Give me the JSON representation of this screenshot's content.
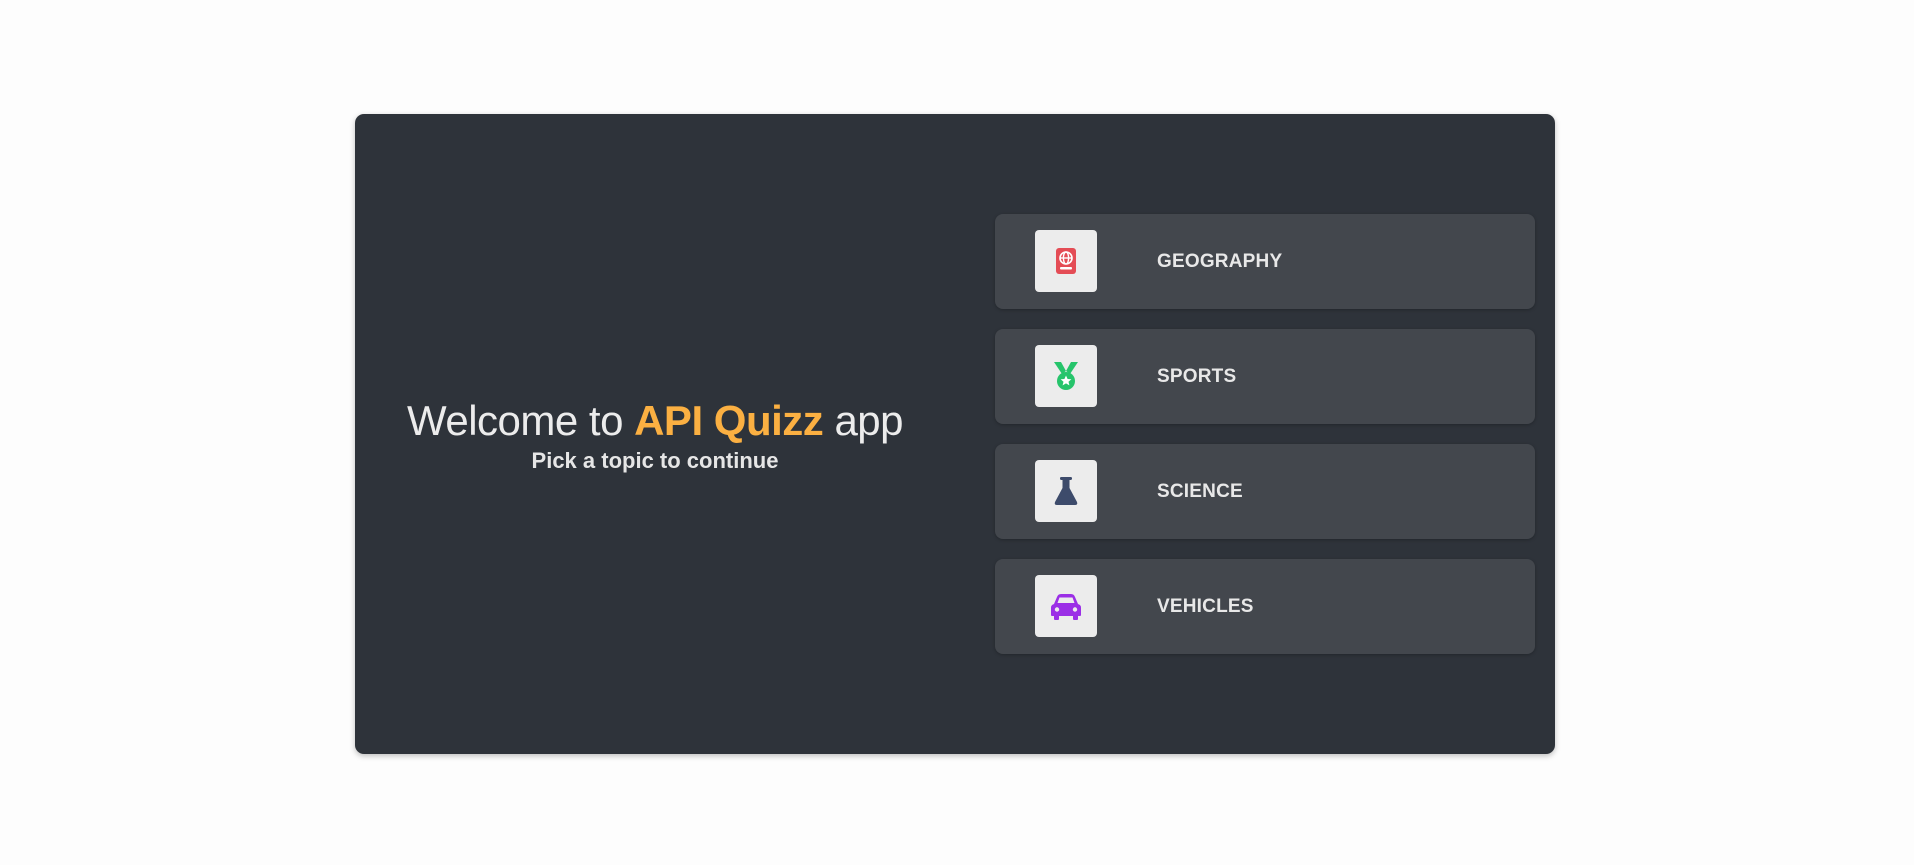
{
  "welcome": {
    "prefix": "Welcome to ",
    "brand": "API Quizz",
    "suffix": " app",
    "subtitle": "Pick a topic to continue"
  },
  "topics": [
    {
      "label": "GEOGRAPHY",
      "icon": "globe-book-icon",
      "color": "#e44c55"
    },
    {
      "label": "SPORTS",
      "icon": "medal-icon",
      "color": "#26c46b"
    },
    {
      "label": "SCIENCE",
      "icon": "flask-icon",
      "color": "#3d4b6b"
    },
    {
      "label": "VEHICLES",
      "icon": "car-icon",
      "color": "#9b2fe6"
    }
  ],
  "colors": {
    "card_background": "#2e333a",
    "topic_background": "#43474d",
    "brand_accent": "#fbb042"
  }
}
